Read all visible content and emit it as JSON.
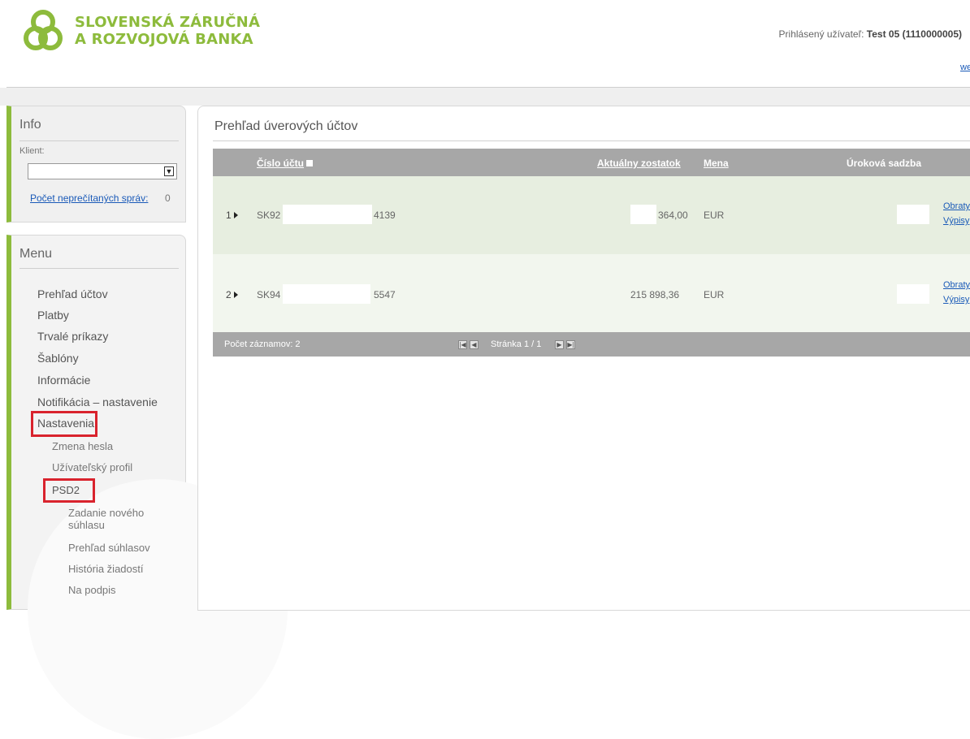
{
  "header": {
    "logo_line1": "SLOVENSKÁ ZÁRUČNÁ",
    "logo_line2": "A ROZVOJOVÁ BANKA",
    "user_label": "Prihlásený užívateľ:",
    "user_name": "Test 05 (1110000005)",
    "cut_link": "we"
  },
  "info": {
    "title": "Info",
    "klient_label": "Klient:",
    "klient_value": "",
    "messages_label": "Počet neprečítaných správ:",
    "messages_count": "0"
  },
  "menu": {
    "title": "Menu",
    "items": [
      "Prehľad účtov",
      "Platby",
      "Trvalé príkazy",
      "Šablóny",
      "Informácie",
      "Notifikácia – nastavenie",
      "Nastavenia"
    ],
    "settings_sub": [
      "Zmena hesla",
      "Užívateľský profil",
      "PSD2"
    ],
    "psd2_sub": [
      "Zadanie nového súhlasu",
      "Prehľad súhlasov",
      "História žiadostí",
      "Na podpis"
    ],
    "highlight_color": "#d9232d"
  },
  "main": {
    "title": "Prehľad úverových účtov",
    "columns": {
      "account": "Číslo účtu",
      "balance": "Aktuálny zostatok",
      "currency": "Mena",
      "rate": "Úroková sadzba"
    },
    "rows": [
      {
        "index": "1",
        "account_prefix": "SK92 :",
        "account_suffix": "4139",
        "balance": "364,00",
        "currency": "EUR",
        "link1": "Obraty",
        "link2": "Výpisy"
      },
      {
        "index": "2",
        "account_prefix": "SK94",
        "account_suffix": "5547",
        "balance": "215 898,36",
        "currency": "EUR",
        "link1": "Obraty",
        "link2": "Výpisy"
      }
    ],
    "footer": {
      "records": "Počet záznamov: 2",
      "page": "Stránka 1 / 1"
    }
  },
  "colors": {
    "brand_green": "#8dbb3c",
    "header_gray": "#a7a7a7",
    "link_blue": "#1a5ab8"
  }
}
